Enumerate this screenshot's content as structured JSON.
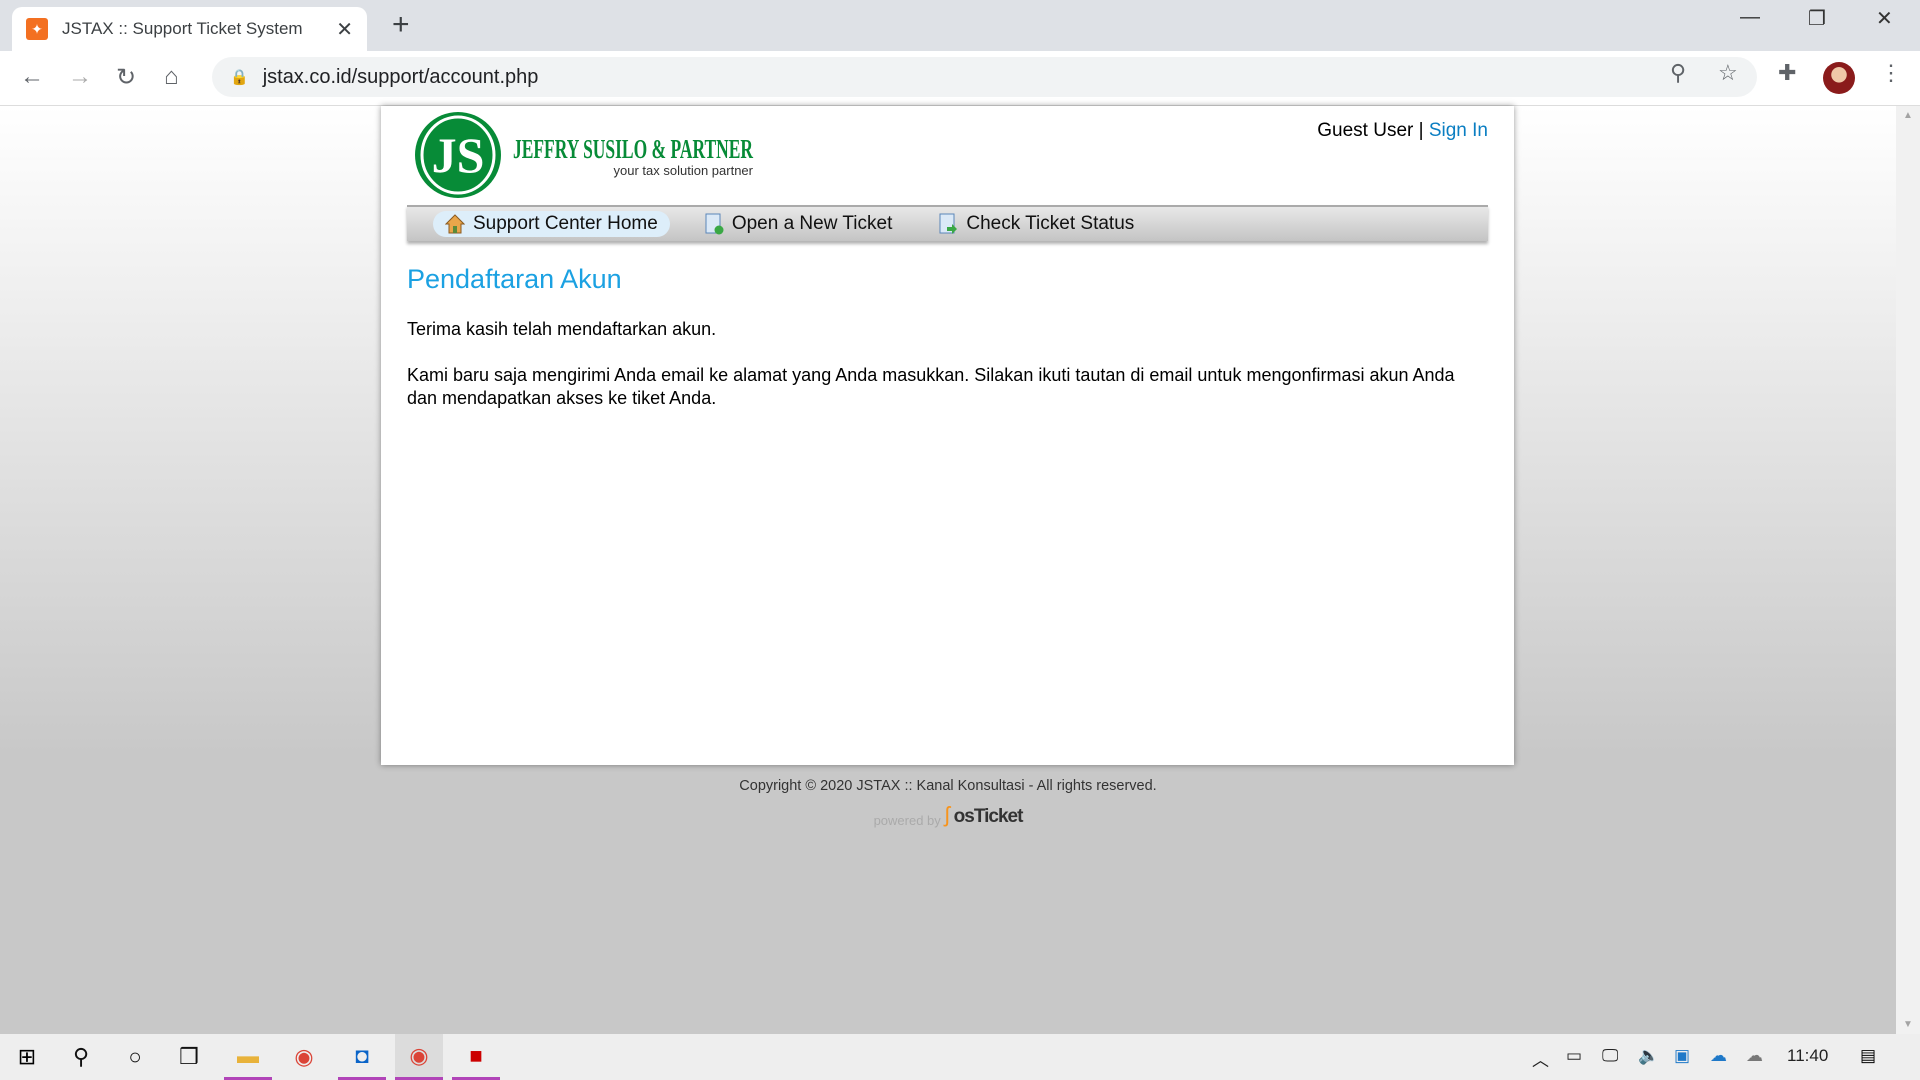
{
  "browser": {
    "tab_title": "JSTAX :: Support Ticket System",
    "url": "jstax.co.id/support/account.php"
  },
  "header": {
    "logo_text": "JEFFRY SUSILO & PARTNER",
    "logo_tagline": "your tax solution partner",
    "guest_label": "Guest User",
    "separator": "|",
    "sign_in": "Sign In"
  },
  "nav": {
    "items": [
      {
        "label": "Support Center Home",
        "icon": "home-icon",
        "active": true
      },
      {
        "label": "Open a New Ticket",
        "icon": "new-ticket-icon",
        "active": false
      },
      {
        "label": "Check Ticket Status",
        "icon": "ticket-status-icon",
        "active": false
      }
    ]
  },
  "main": {
    "title": "Pendaftaran Akun",
    "paragraphs": [
      "Terima kasih telah mendaftarkan akun.",
      "Kami baru saja mengirimi Anda email ke alamat yang Anda masukkan. Silakan ikuti tautan di email untuk mengonfirmasi akun Anda dan mendapatkan akses ke tiket Anda."
    ]
  },
  "footer": {
    "copyright": "Copyright © 2020 JSTAX :: Kanal Konsultasi - All rights reserved.",
    "powered_by": "powered by",
    "brand": "osTicket"
  },
  "taskbar": {
    "clock": "11:40"
  },
  "colors": {
    "accent": "#1ba1e2",
    "link": "#0a7ec2",
    "logo_green": "#078b37"
  }
}
